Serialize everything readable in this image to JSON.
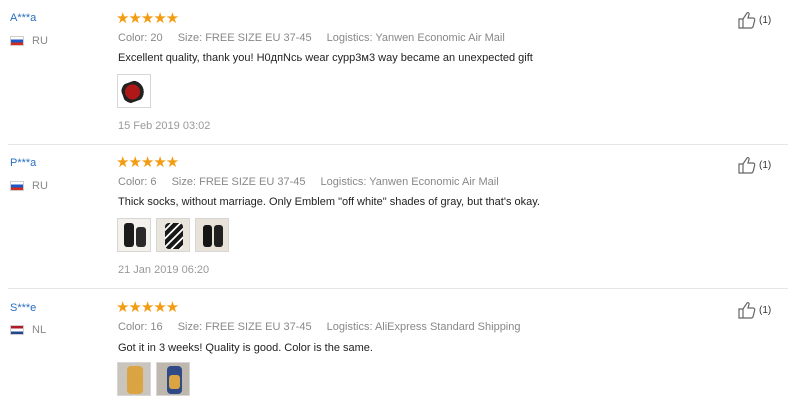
{
  "reviews": [
    {
      "user": "A***a",
      "country": "RU",
      "rating": "★★★★★",
      "color": "Color: 20",
      "size": "Size: FREE SIZE EU 37-45",
      "logistics": "Logistics: Yanwen Economic Air Mail",
      "text": "Excellent quality, thank you! H0дпNсь wear сурр3м3 way became an unexpected gift",
      "date": "15 Feb 2019 03:02",
      "helpful": "(1)"
    },
    {
      "user": "P***a",
      "country": "RU",
      "rating": "★★★★★",
      "color": "Color: 6",
      "size": "Size: FREE SIZE EU 37-45",
      "logistics": "Logistics: Yanwen Economic Air Mail",
      "text": "Thick socks, without marriage. Only Emblem \"off white\" shades of gray, but that's okay.",
      "date": "21 Jan 2019 06:20",
      "helpful": "(1)"
    },
    {
      "user": "S***e",
      "country": "NL",
      "rating": "★★★★★",
      "color": "Color: 16",
      "size": "Size: FREE SIZE EU 37-45",
      "logistics": "Logistics: AliExpress Standard Shipping",
      "text": "Got it in 3 weeks! Quality is good. Color is the same.",
      "date": "",
      "helpful": "(1)"
    }
  ],
  "icons": {
    "helpful": "thumbs-up-icon",
    "flag_ru": "russia-flag-icon",
    "flag_nl": "netherlands-flag-icon"
  },
  "colors": {
    "star": "#f39c12",
    "user_link": "#2a6fbf",
    "meta_text": "#888888"
  }
}
